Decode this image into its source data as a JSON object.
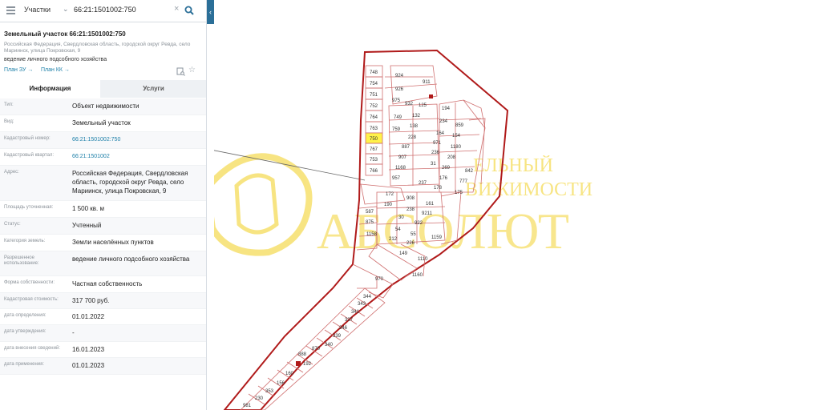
{
  "search": {
    "layer": "Участки",
    "query": "66:21:1501002:750"
  },
  "object": {
    "title": "Земельный участок 66:21:1501002:750",
    "address": "Российская Федерация, Свердловская область, городской округ Ревда, село Мариинск, улица Покровская, 9",
    "purpose": "ведение личного подсобного хозяйства",
    "plan_zu": "План ЗУ →",
    "plan_kk": "План КК →"
  },
  "tabs": {
    "info": "Информация",
    "services": "Услуги"
  },
  "rows": [
    {
      "label": "Тип:",
      "value": "Объект недвижимости"
    },
    {
      "label": "Вид:",
      "value": "Земельный участок"
    },
    {
      "label": "Кадастровый номер:",
      "value": "66:21:1501002:750"
    },
    {
      "label": "Кадастровый квартал:",
      "value": "66:21:1501002"
    },
    {
      "label": "Адрес:",
      "value": "Российская Федерация, Свердловская область, городской округ Ревда, село Мариинск, улица Покровская, 9"
    },
    {
      "label": "Площадь уточненная:",
      "value": "1 500 кв. м"
    },
    {
      "label": "Статус:",
      "value": "Учтенный"
    },
    {
      "label": "Категория земель:",
      "value": "Земли населённых пунктов"
    },
    {
      "label": "Разрешенное использование:",
      "value": "ведение личного подсобного хозяйства"
    },
    {
      "label": "Форма собственности:",
      "value": "Частная собственность"
    },
    {
      "label": "Кадастровая стоимость:",
      "value": "317 700 руб."
    },
    {
      "label": "дата определения:",
      "value": "01.01.2022"
    },
    {
      "label": "дата утверждения:",
      "value": "-"
    },
    {
      "label": "дата внесения сведений:",
      "value": "16.01.2023"
    },
    {
      "label": "дата применения:",
      "value": "01.01.2023"
    }
  ],
  "map": {
    "watermark_top": "ЕЛЬНЫЙ",
    "watermark_mid": "ВИЖИМОСТИ",
    "watermark_big": "АБСОЛЮТ",
    "parcels": [
      "748",
      "754",
      "751",
      "752",
      "764",
      "763",
      "750",
      "767",
      "753",
      "766",
      "924",
      "926",
      "911",
      "975",
      "932",
      "125",
      "749",
      "132",
      "759",
      "138",
      "228",
      "887",
      "907",
      "1168",
      "957",
      "194",
      "234",
      "164",
      "154",
      "971",
      "1180",
      "236",
      "208",
      "31",
      "269",
      "176",
      "237",
      "178",
      "842",
      "777",
      "175",
      "172",
      "190",
      "908",
      "161",
      "587",
      "238",
      "9211",
      "30",
      "922",
      "875",
      "54",
      "55",
      "1158",
      "212",
      "226",
      "149",
      "970",
      "1110",
      "1159",
      "1160",
      "344",
      "343",
      "341",
      "337",
      "346",
      "339",
      "340",
      "870",
      "888",
      "192",
      "160",
      "156",
      "353",
      "230",
      "981",
      "859"
    ],
    "highlight": "750"
  },
  "colors": {
    "boundary": "#b01a1a",
    "parcel_line": "#cf6f6f",
    "highlight": "#fff24a",
    "link": "#1c7fa8",
    "watermark": "#f2cf1d"
  }
}
